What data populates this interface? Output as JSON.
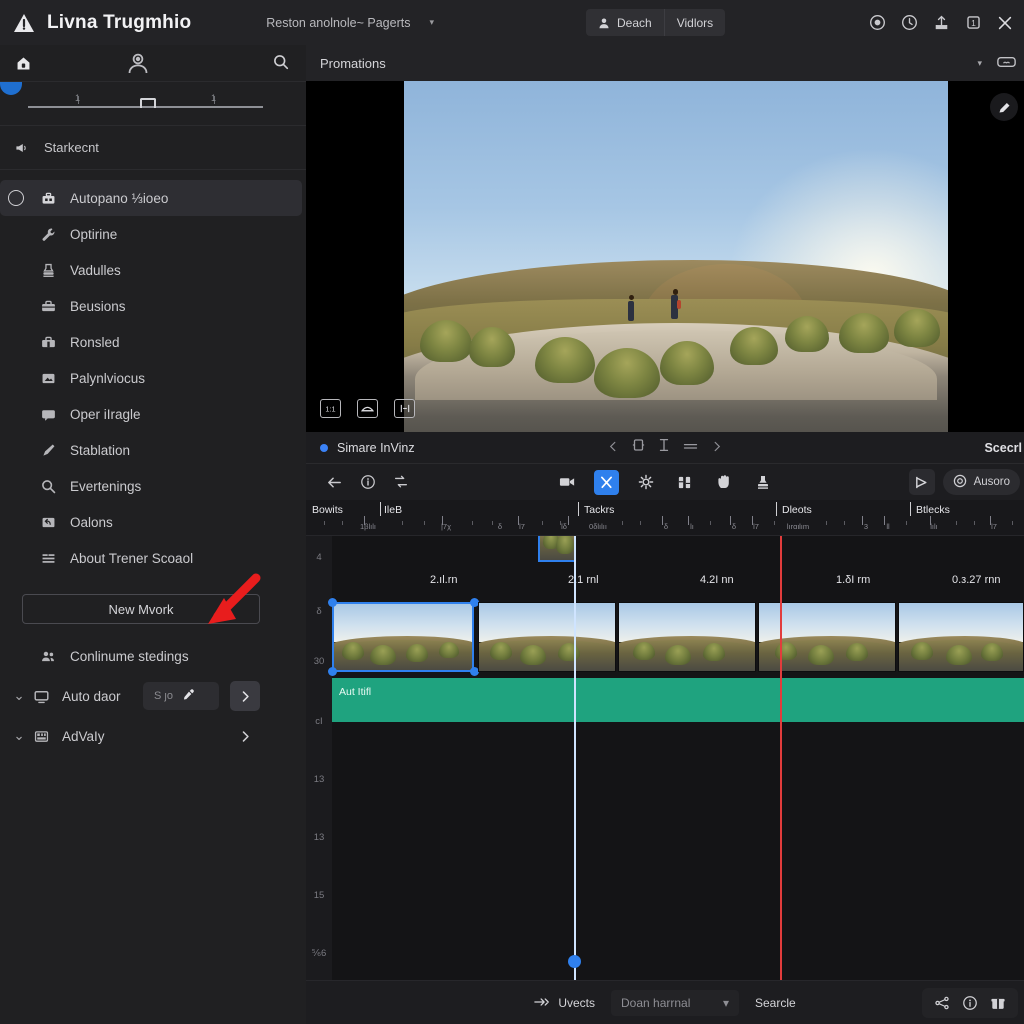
{
  "titlebar": {
    "brand": "Livna Trugmhio",
    "logo_icon": "triangle-warning-icon",
    "menu": "Reston anolnole~ Pagerts",
    "menu_caret": "▾",
    "segment": [
      {
        "label": "Deach",
        "icon": "person-icon"
      },
      {
        "label": "Vidlors",
        "icon": ""
      }
    ],
    "icons": [
      "record-circle-icon",
      "clock-icon",
      "export-upload-icon",
      "single-panel-icon",
      "close-icon"
    ]
  },
  "sidebar": {
    "toolbar": {
      "home_icon": "home-lock-icon",
      "avatar_icon": "person-avatar-icon",
      "search_icon": "search-icon"
    },
    "slider": {
      "value_pct": 48,
      "tick_labels": [
        "1",
        "1"
      ]
    },
    "section": {
      "label": "Starkecnt",
      "icon": "megaphone-icon"
    },
    "items": [
      {
        "label": "Autopano ⅓ioeo",
        "icon": "toolbox-icon",
        "selected": true,
        "radio": true
      },
      {
        "label": "Optirine",
        "icon": "wrench-icon",
        "selected": false
      },
      {
        "label": "Vadulles",
        "icon": "stamp-icon",
        "selected": false
      },
      {
        "label": "Beusions",
        "icon": "briefcase-icon",
        "selected": false
      },
      {
        "label": "Ronsled",
        "icon": "briefcase-icon",
        "selected": false
      },
      {
        "label": "Palynlviocus",
        "icon": "image-icon",
        "selected": false
      },
      {
        "label": "Oper iIragle",
        "icon": "chat-icon",
        "selected": false
      },
      {
        "label": "Stablation",
        "icon": "pen-icon",
        "selected": false
      },
      {
        "label": "Evertenings",
        "icon": "search-icon",
        "selected": false
      },
      {
        "label": "Oalons",
        "icon": "undo-frame-icon",
        "selected": false
      },
      {
        "label": "About Trener Scoaol",
        "icon": "list-icon",
        "selected": false
      }
    ],
    "new_work_button": "New Mvork",
    "continue_item": {
      "label": "Conlinume stedings",
      "icon": "people-icon"
    },
    "auto_row": {
      "label": "Auto daor",
      "icon": "monitor-icon",
      "chevron": "⌄",
      "pill_text": "S ȷo",
      "pill_icon": "eyedropper-icon",
      "expand": "›"
    },
    "advaly_row": {
      "label": "AdVaIy",
      "icon": "grid-icon",
      "chevron": "⌄",
      "expand": "›"
    },
    "annotation": {
      "type": "red-arrow",
      "points_to": "New Mvork"
    }
  },
  "breadcrumb": {
    "label": "Promations",
    "caret": "▾",
    "vr_icon": "vr-headset-icon"
  },
  "preview": {
    "overlay_buttons": [
      "frame-11-icon",
      "panorama-icon",
      "fisheye-icon"
    ],
    "edit_icon": "pencil-edit-icon"
  },
  "timeline": {
    "header": {
      "title": "Simare InVinz",
      "dot_color": "#3b82f6",
      "center_icons": [
        "prev-arrow-icon",
        "crop-frame-icon",
        "text-cursor-icon",
        "equals-icon",
        "next-arrow-icon"
      ],
      "right_label": "Scecrl"
    },
    "tools": {
      "left_icons": [
        "back-arrow-icon",
        "info-icon",
        "flip-icon"
      ],
      "center": [
        {
          "icon": "video-camera-icon",
          "active": false
        },
        {
          "icon": "scissors-cut-icon",
          "active": true
        },
        {
          "icon": "gear-icon",
          "active": false
        },
        {
          "icon": "columns-icon",
          "active": false
        },
        {
          "icon": "hand-icon",
          "active": false
        },
        {
          "icon": "stamp-tool-icon",
          "active": false
        }
      ],
      "right_icon": "marker-flag-icon",
      "right_chip": {
        "icon": "target-icon",
        "label": "Ausoro"
      }
    },
    "ruler": {
      "markers": [
        {
          "label": "Bowits",
          "x_pct": 1.0
        },
        {
          "label": "IleB",
          "x_pct": 11.0
        },
        {
          "label": "Tackrs",
          "x_pct": 38.5
        },
        {
          "label": "Dleots",
          "x_pct": 68.0
        },
        {
          "label": "Btlecks",
          "x_pct": 86.5
        }
      ],
      "tick_labels": [
        "1βlılı",
        "|7χ",
        "δ",
        "l7",
        "lδ",
        "0δlılıı",
        "δ",
        "lı",
        "δ",
        "l7",
        "lırαιlım",
        "3",
        "ll",
        "lılı",
        "l7"
      ]
    },
    "gutter_labels": [
      "4",
      "δ",
      "30",
      "cI",
      "13",
      "13",
      "15",
      "⅚6"
    ],
    "clips": [
      {
        "time_label": "2.ıl.rn",
        "selected": true
      },
      {
        "time_label": "2.1 rnl",
        "selected": false
      },
      {
        "time_label": "4.2I nn",
        "selected": false
      },
      {
        "time_label": "1.δI rm",
        "selected": false
      },
      {
        "time_label": "0.з.27 rnn",
        "selected": false
      }
    ],
    "audio_track": {
      "label": "Aut Itifl",
      "color": "#1fa37f"
    },
    "playhead_blue_pct": 38.5,
    "playhead_red_pct": 66.0
  },
  "statusbar": {
    "left_label": "Uvects",
    "left_icon": "arrows-icon",
    "select_value": "Doan harrnal",
    "select_caret": "▾",
    "right_label": "Searcle",
    "icons": [
      "share-node-icon",
      "info-circle-icon",
      "gift-icon"
    ]
  }
}
